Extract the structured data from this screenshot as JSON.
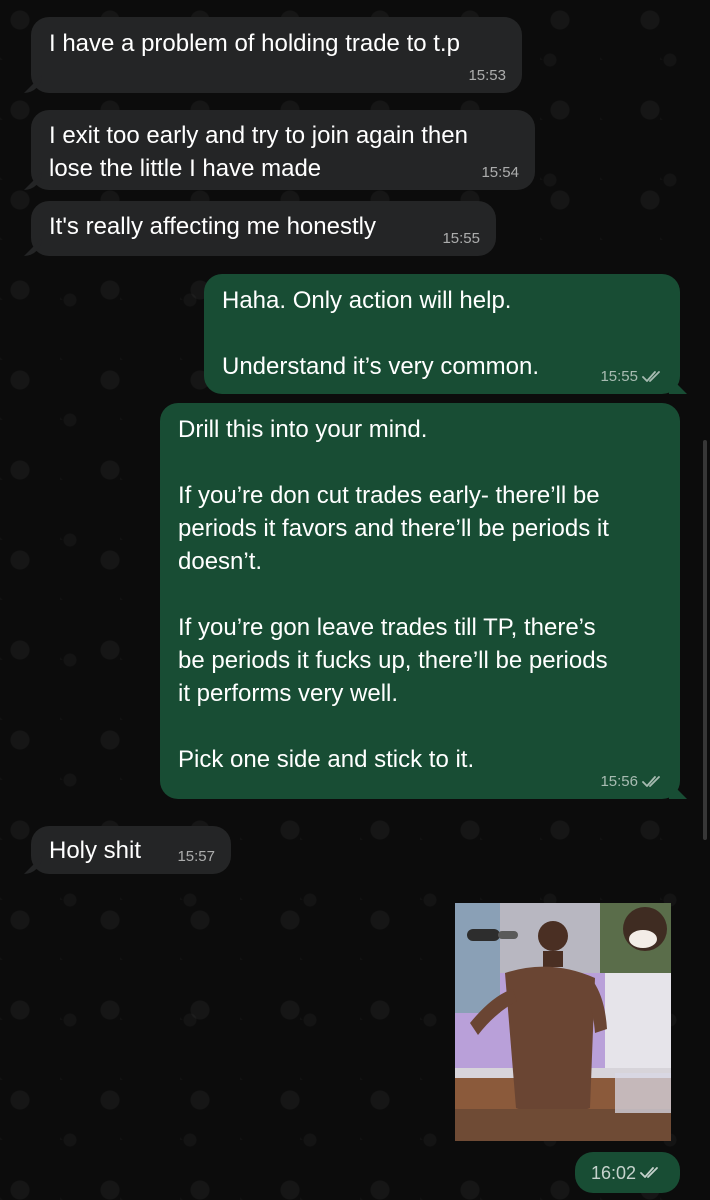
{
  "messages": [
    {
      "text": "I have a problem of holding trade to t.p",
      "time": "15:53"
    },
    {
      "text": "I exit too early and try to join again then\nlose the little I have made",
      "time": "15:54"
    },
    {
      "text": "It's really affecting me honestly",
      "time": "15:55"
    },
    {
      "text": "Haha. Only action will help.\n\nUnderstand it’s very common.",
      "time": "15:55"
    },
    {
      "text": "Drill this into your mind.\n\nIf you’re don cut trades early- there’ll be\nperiods it favors and there’ll be periods it\ndoesn’t.\n\nIf you’re gon leave trades till TP, there’s\nbe periods it fucks up, there’ll be periods\nit performs very well.\n\nPick one side and stick to it.",
      "time": "15:56"
    },
    {
      "text": "Holy shit",
      "time": "15:57"
    }
  ],
  "media_message": {
    "time": "16:02"
  },
  "colors": {
    "incoming_bubble": "#242526",
    "outgoing_bubble": "#184d34",
    "background": "#0b0b0b",
    "timestamp": "#a6a6a6"
  },
  "icons": {
    "read_receipt": "double-check-icon"
  }
}
